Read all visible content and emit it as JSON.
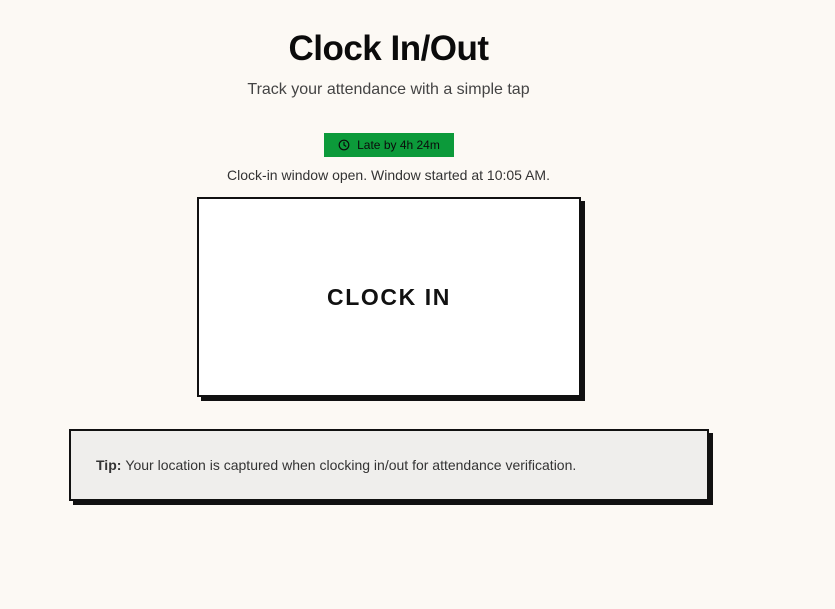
{
  "header": {
    "title": "Clock In/Out",
    "subtitle": "Track your attendance with a simple tap"
  },
  "status": {
    "badge_text": "Late by 4h 24m",
    "badge_icon": "clock-icon",
    "badge_color": "#0c9a3a",
    "window_note": "Clock-in window open. Window started at 10:05 AM."
  },
  "action": {
    "clock_button_label": "CLOCK IN"
  },
  "tip": {
    "label": "Tip:",
    "text": "Your location is captured when clocking in/out for attendance verification."
  }
}
